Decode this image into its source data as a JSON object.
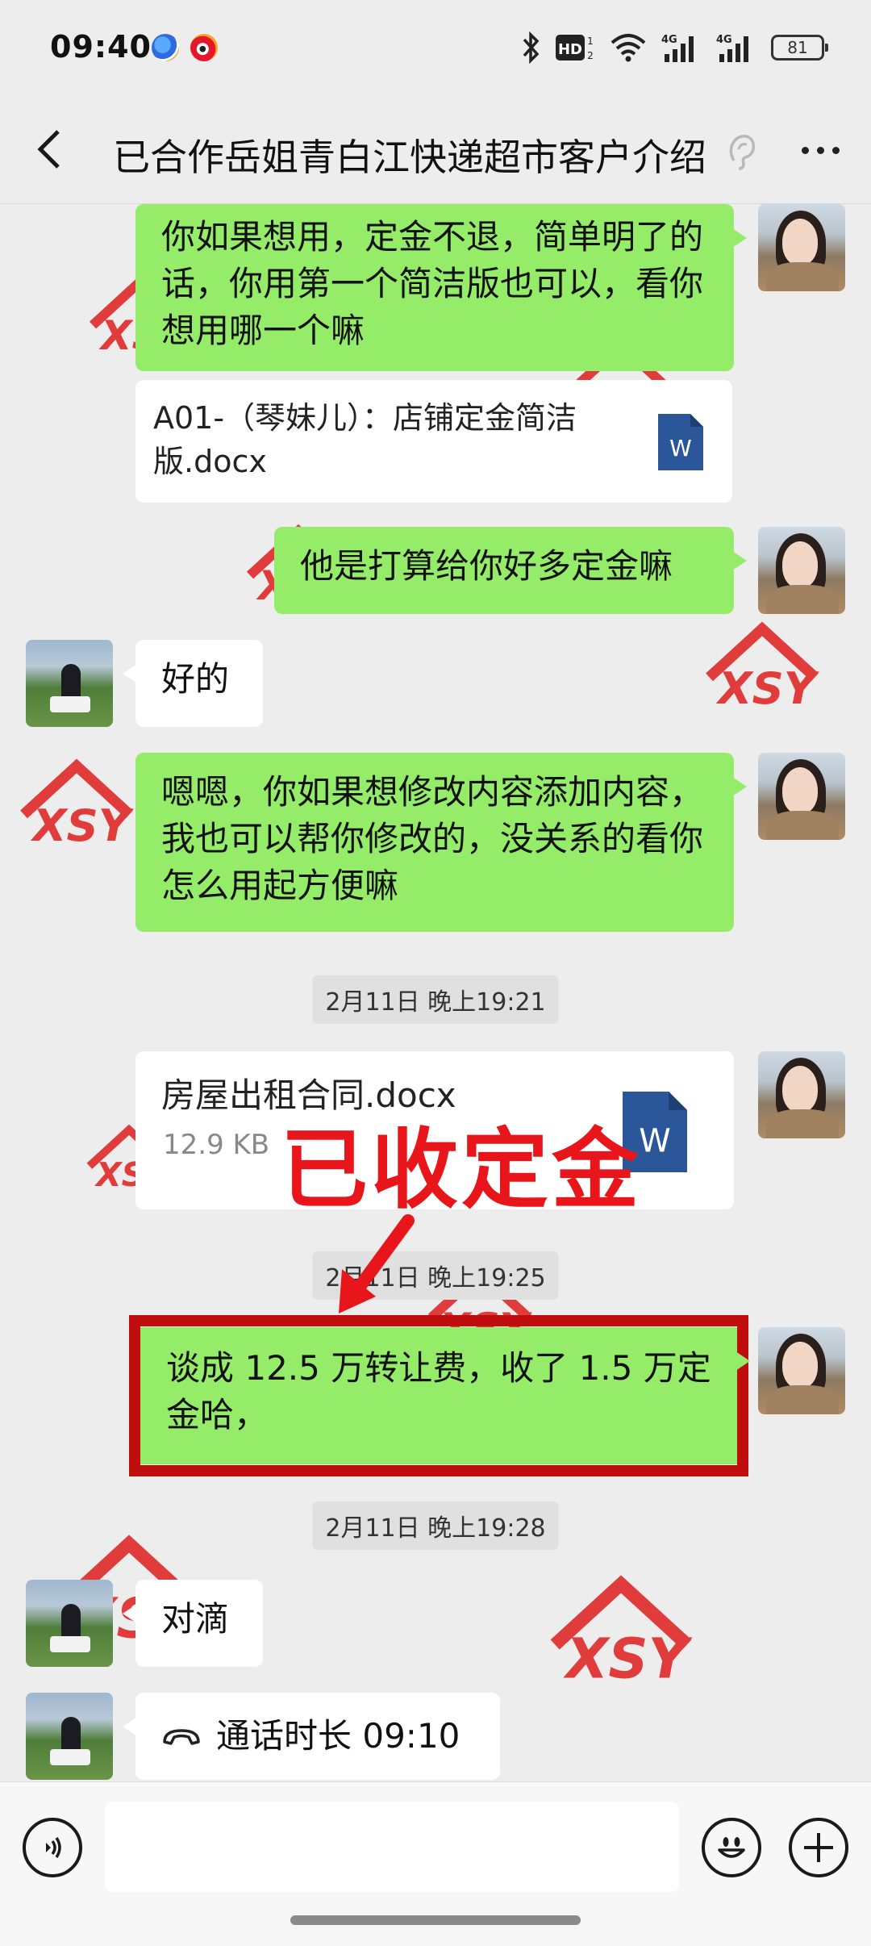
{
  "status_bar": {
    "time": "09:40",
    "battery": "81",
    "icons": [
      "cloud-app-icon",
      "weibo-icon",
      "bluetooth-icon",
      "hd-icon",
      "wifi-icon",
      "4g-signal-icon",
      "4g-signal-icon",
      "battery-icon"
    ]
  },
  "header": {
    "title": "已合作岳姐青白江快递超市客户介绍",
    "back_icon": "chevron-left-icon",
    "ear_icon": "ear-icon",
    "more_icon": "more-dots-icon"
  },
  "messages": [
    {
      "side": "me",
      "type": "text",
      "text": "你如果想用，定金不退，简单明了的话，你用第一个简洁版也可以，看你想用哪一个嘛"
    },
    {
      "side": "me",
      "type": "file",
      "file_name": "A01-（琴妹儿）：店铺定金简洁版.docx"
    },
    {
      "side": "me",
      "type": "text",
      "text": "他是打算给你好多定金嘛"
    },
    {
      "side": "other",
      "type": "text",
      "text": "好的"
    },
    {
      "side": "me",
      "type": "text",
      "text": "嗯嗯，你如果想修改内容添加内容，我也可以帮你修改的，没关系的看你怎么用起方便嘛"
    },
    {
      "type": "time",
      "text": "2月11日 晚上19:21"
    },
    {
      "side": "me",
      "type": "file",
      "file_name": "房屋出租合同.docx",
      "file_size": "12.9 KB"
    },
    {
      "type": "time",
      "text": "2月11日 晚上19:25"
    },
    {
      "side": "me",
      "type": "text",
      "text": "谈成 12.5 万转让费，收了 1.5 万定金哈，"
    },
    {
      "type": "time",
      "text": "2月11日 晚上19:28"
    },
    {
      "side": "other",
      "type": "text",
      "text": "对滴"
    },
    {
      "side": "other",
      "type": "call",
      "text": "通话时长 09:10"
    }
  ],
  "annotation": {
    "text": "已收定金",
    "color": "#e8161a"
  },
  "input_bar": {
    "voice_icon": "voice-icon",
    "emoji_icon": "emoji-icon",
    "plus_icon": "plus-icon",
    "placeholder": ""
  },
  "colors": {
    "my_bubble": "#95ec69",
    "other_bubble": "#ffffff",
    "background": "#ededed",
    "highlight": "#c00d0d"
  }
}
